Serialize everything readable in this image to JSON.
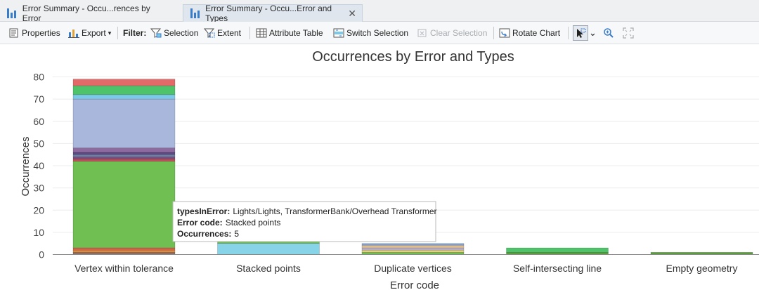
{
  "tabs": [
    {
      "label": "Error Summary - Occu...rences by Error",
      "icon": "bar-chart-icon"
    },
    {
      "label": "Error Summary - Occu...Error and Types",
      "icon": "bar-chart-icon",
      "close": "✕"
    }
  ],
  "toolbar": {
    "properties": "Properties",
    "export": "Export",
    "export_caret": "▾",
    "filter_label": "Filter:",
    "selection": "Selection",
    "extent": "Extent",
    "attribute_table": "Attribute Table",
    "switch_selection": "Switch Selection",
    "clear_selection": "Clear Selection",
    "rotate_chart": "Rotate Chart",
    "select_caret": "⌄"
  },
  "tooltip": {
    "line1_key": "typesInError:",
    "line1_val": "Lights/Lights, TransformerBank/Overhead Transformer",
    "line2_key": "Error code:",
    "line2_val": "Stacked points",
    "line3_key": "Occurrences:",
    "line3_val": "5"
  },
  "chart_data": {
    "type": "bar",
    "title": "Occurrences by Error and Types",
    "xlabel": "Error code",
    "ylabel": "Occurrences",
    "ylim": [
      0,
      80
    ],
    "yticks": [
      0,
      10,
      20,
      30,
      40,
      50,
      60,
      70,
      80
    ],
    "grid": true,
    "stacked": true,
    "categories": [
      "Vertex within tolerance",
      "Stacked points",
      "Duplicate vertices",
      "Self-intersecting line",
      "Empty geometry"
    ],
    "stacks": [
      [
        {
          "value": 1,
          "color": "#8d6e63"
        },
        {
          "value": 1,
          "color": "#e08a3c"
        },
        {
          "value": 1,
          "color": "#d9634f"
        },
        {
          "value": 39,
          "color": "#6fbf52"
        },
        {
          "value": 1,
          "color": "#c44d58"
        },
        {
          "value": 1,
          "color": "#7a4f7e"
        },
        {
          "value": 1,
          "color": "#6f7fa8"
        },
        {
          "value": 1,
          "color": "#5a4b82"
        },
        {
          "value": 2,
          "color": "#8e6aa1"
        },
        {
          "value": 22,
          "color": "#a9b7dd"
        },
        {
          "value": 2,
          "color": "#7cc8e8"
        },
        {
          "value": 4,
          "color": "#4fc36a"
        },
        {
          "value": 3,
          "color": "#e46a6a"
        }
      ],
      [
        {
          "value": 5,
          "color": "#87d4e9"
        },
        {
          "value": 1,
          "color": "#6fbf52"
        },
        {
          "value": 2,
          "color": "#e9f5e0"
        },
        {
          "value": 1,
          "color": "#f2d6d6"
        }
      ],
      [
        {
          "value": 1,
          "color": "#6fbf52"
        },
        {
          "value": 1,
          "color": "#e7d07a"
        },
        {
          "value": 1,
          "color": "#b9b0d6"
        },
        {
          "value": 1,
          "color": "#e7c48a"
        },
        {
          "value": 0.5,
          "color": "#a9b7dd"
        },
        {
          "value": 0.5,
          "color": "#8fb4d8"
        }
      ],
      [
        {
          "value": 1,
          "color": "#5a9e3d"
        },
        {
          "value": 2,
          "color": "#4fc36a"
        }
      ],
      [
        {
          "value": 1,
          "color": "#5a9e3d"
        }
      ]
    ]
  }
}
